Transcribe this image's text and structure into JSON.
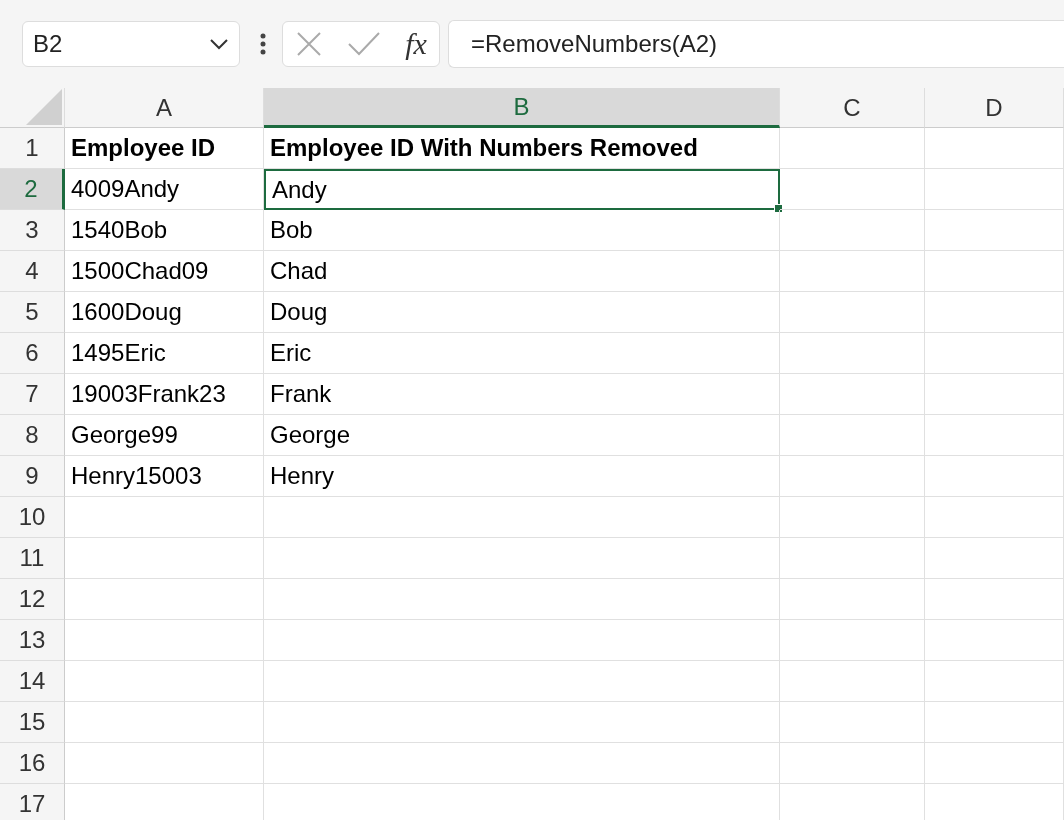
{
  "name_box": {
    "value": "B2"
  },
  "formula_bar": {
    "function_label": "fx",
    "formula": "=RemoveNumbers(A2)"
  },
  "columns": [
    {
      "label": "A",
      "selected": false
    },
    {
      "label": "B",
      "selected": true
    },
    {
      "label": "C",
      "selected": false
    },
    {
      "label": "D",
      "selected": false
    }
  ],
  "rows": [
    {
      "header": "1",
      "selected": false,
      "kind": "header",
      "cells": [
        {
          "text": "Employee ID",
          "selected": false
        },
        {
          "text": "Employee ID With Numbers Removed",
          "selected": false
        }
      ]
    },
    {
      "header": "2",
      "selected": true,
      "kind": "data",
      "cells": [
        {
          "text": "4009Andy",
          "selected": false
        },
        {
          "text": "Andy",
          "selected": true
        }
      ]
    },
    {
      "header": "3",
      "selected": false,
      "kind": "data",
      "cells": [
        {
          "text": "1540Bob",
          "selected": false
        },
        {
          "text": "Bob",
          "selected": false
        }
      ]
    },
    {
      "header": "4",
      "selected": false,
      "kind": "data",
      "cells": [
        {
          "text": "1500Chad09",
          "selected": false
        },
        {
          "text": "Chad",
          "selected": false
        }
      ]
    },
    {
      "header": "5",
      "selected": false,
      "kind": "data",
      "cells": [
        {
          "text": "1600Doug",
          "selected": false
        },
        {
          "text": "Doug",
          "selected": false
        }
      ]
    },
    {
      "header": "6",
      "selected": false,
      "kind": "data",
      "cells": [
        {
          "text": "1495Eric",
          "selected": false
        },
        {
          "text": "Eric",
          "selected": false
        }
      ]
    },
    {
      "header": "7",
      "selected": false,
      "kind": "data",
      "cells": [
        {
          "text": "19003Frank23",
          "selected": false
        },
        {
          "text": "Frank",
          "selected": false
        }
      ]
    },
    {
      "header": "8",
      "selected": false,
      "kind": "data",
      "cells": [
        {
          "text": "George99",
          "selected": false
        },
        {
          "text": "George",
          "selected": false
        }
      ]
    },
    {
      "header": "9",
      "selected": false,
      "kind": "data",
      "cells": [
        {
          "text": "Henry15003",
          "selected": false
        },
        {
          "text": "Henry",
          "selected": false
        }
      ]
    },
    {
      "header": "10",
      "selected": false,
      "kind": "data"
    },
    {
      "header": "11",
      "selected": false,
      "kind": "data"
    },
    {
      "header": "12",
      "selected": false,
      "kind": "data"
    },
    {
      "header": "13",
      "selected": false,
      "kind": "data"
    },
    {
      "header": "14",
      "selected": false,
      "kind": "data"
    },
    {
      "header": "15",
      "selected": false,
      "kind": "data"
    },
    {
      "header": "16",
      "selected": false,
      "kind": "data"
    },
    {
      "header": "17",
      "selected": false,
      "kind": "data"
    }
  ]
}
